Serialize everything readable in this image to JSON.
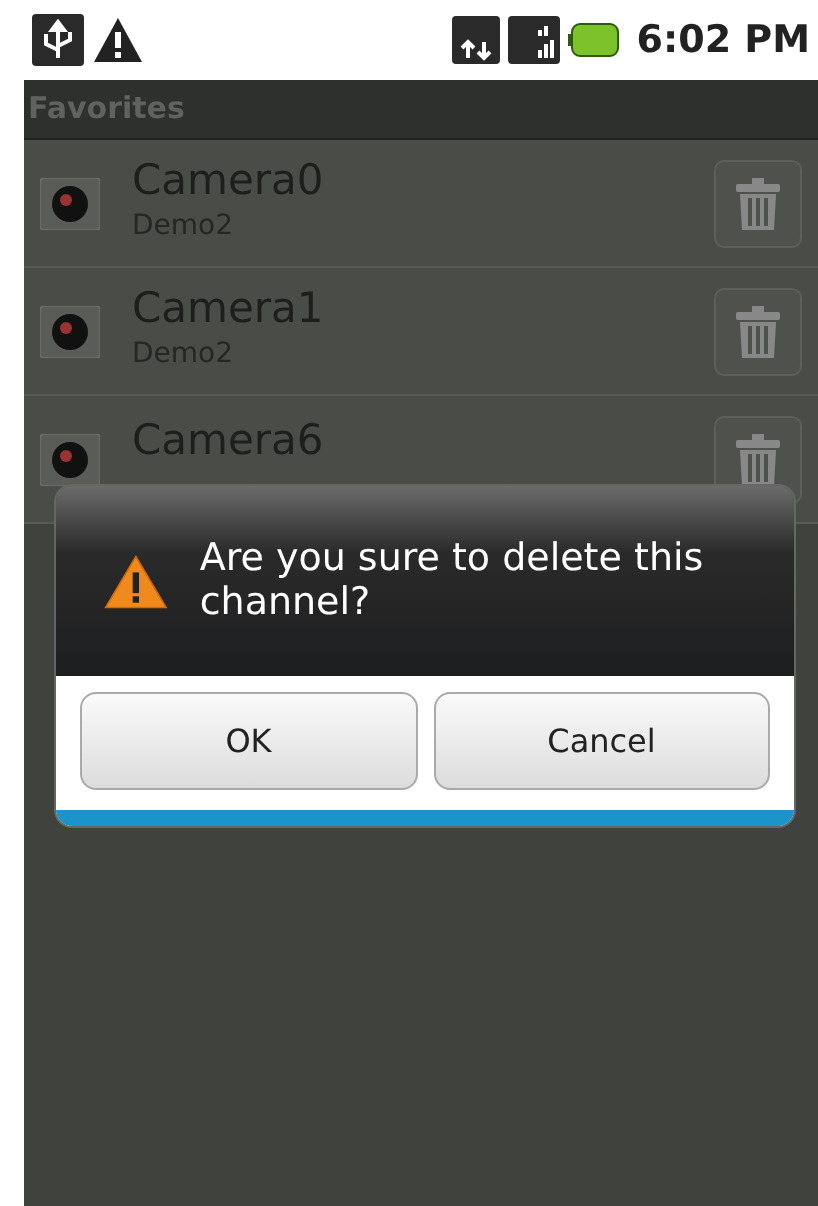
{
  "status_bar": {
    "time": "6:02 PM"
  },
  "title": "Favorites",
  "channels": [
    {
      "name": "Camera0",
      "group": "Demo2"
    },
    {
      "name": "Camera1",
      "group": "Demo2"
    },
    {
      "name": "Camera6"
    }
  ],
  "dialog": {
    "message": "Are you sure to delete this channel?",
    "buttons": [
      "OK",
      "Cancel"
    ]
  }
}
